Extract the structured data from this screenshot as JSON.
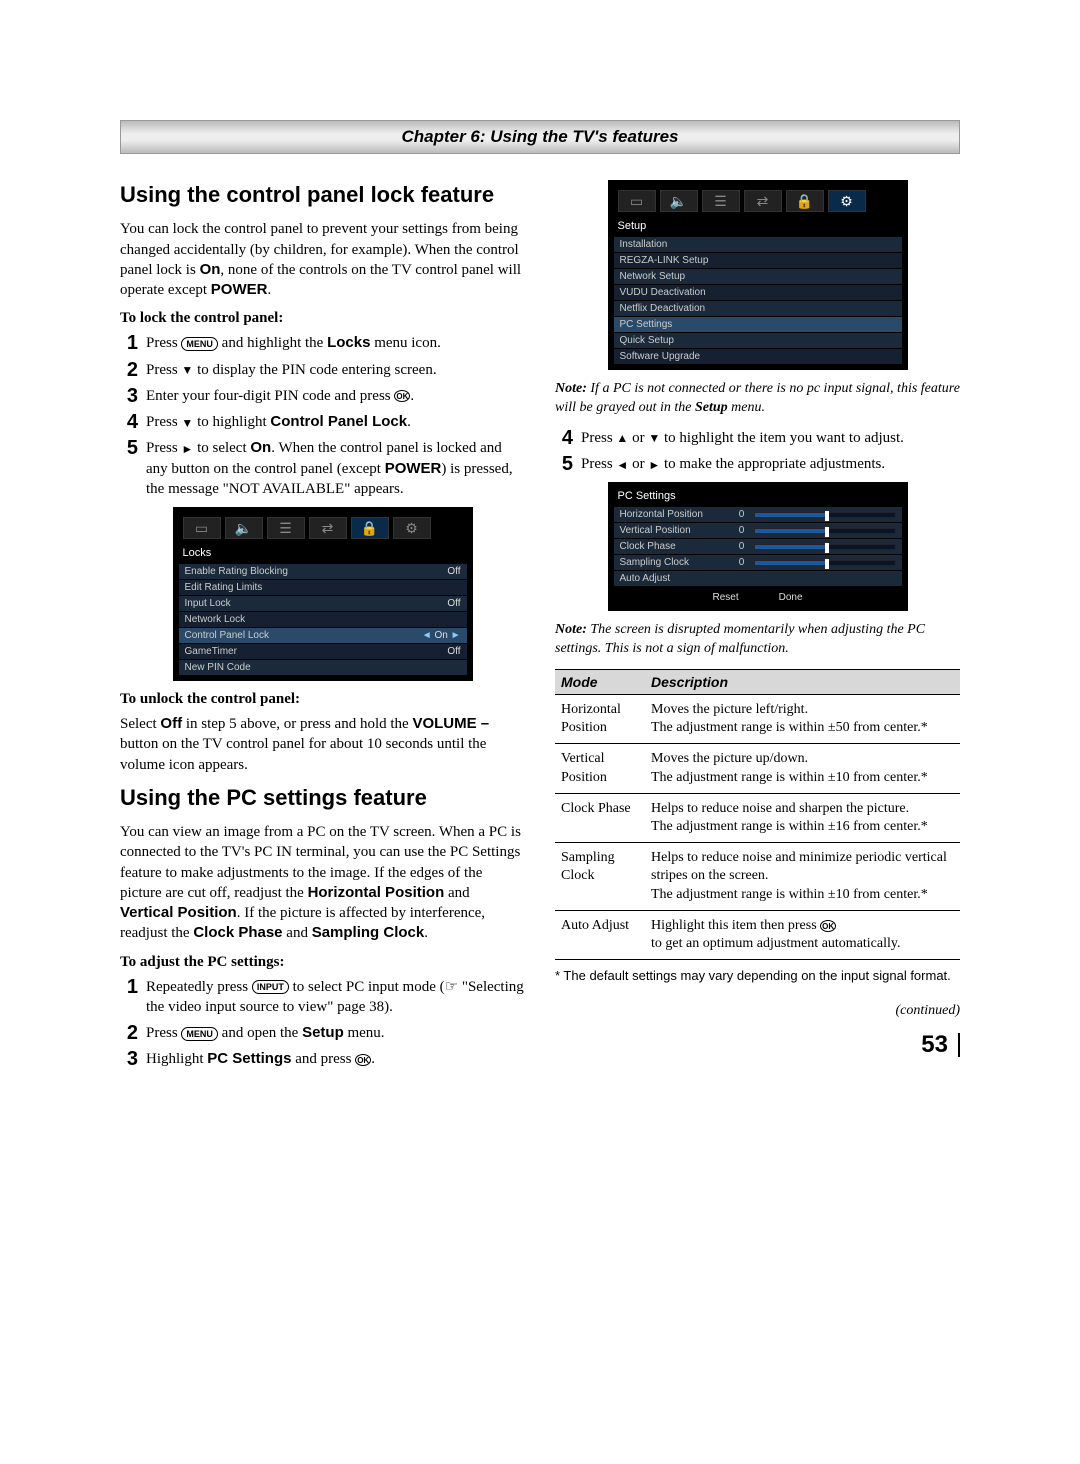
{
  "chapter_bar": "Chapter 6: Using the TV's features",
  "page_number": "53",
  "continued": "(continued)",
  "left": {
    "h1": "Using the control panel lock feature",
    "p1_a": "You can lock the control panel to prevent your settings from being changed accidentally (by children, for example). When the control panel lock is ",
    "p1_on": "On",
    "p1_b": ", none of the controls on the TV control panel will operate except ",
    "p1_power": "POWER",
    "p1_c": ".",
    "sub_lock": "To lock the control panel:",
    "steps_lock": {
      "s1_a": "Press ",
      "s1_btn": "MENU",
      "s1_b": " and highlight the ",
      "s1_c": "Locks",
      "s1_d": " menu icon.",
      "s2_a": "Press ",
      "s2_tri": "▼",
      "s2_b": " to display the PIN code entering screen.",
      "s3_a": "Enter your four-digit PIN code and press ",
      "s3_btn": "OK",
      "s3_b": ".",
      "s4_a": "Press ",
      "s4_tri": "▼",
      "s4_b": " to highlight ",
      "s4_c": "Control Panel Lock",
      "s4_d": ".",
      "s5_a": "Press ",
      "s5_tri": "►",
      "s5_b": " to select ",
      "s5_on": "On",
      "s5_c": ". When the control panel is locked and any button on the control panel (except ",
      "s5_power": "POWER",
      "s5_d": ") is pressed, the message \"NOT AVAILABLE\" appears."
    },
    "locks_menu": {
      "title": "Locks",
      "rows": [
        {
          "label": "Enable Rating Blocking",
          "value": "Off"
        },
        {
          "label": "Edit Rating Limits",
          "value": ""
        },
        {
          "label": "Input Lock",
          "value": "Off"
        },
        {
          "label": "Network Lock",
          "value": ""
        },
        {
          "label": "Control Panel Lock",
          "value": "On",
          "selected": true
        },
        {
          "label": "GameTimer",
          "value": "Off"
        },
        {
          "label": "New PIN Code",
          "value": ""
        }
      ]
    },
    "sub_unlock": "To unlock the control panel:",
    "unlock_a": "Select ",
    "unlock_off": "Off",
    "unlock_b": " in step 5 above, or press and hold the ",
    "unlock_vol": "VOLUME –",
    "unlock_c": " button on the TV control panel for about 10 seconds until the volume icon appears.",
    "h2": "Using the PC settings feature",
    "p2_a": "You can view an image from a PC on the TV screen. When a PC is connected to the TV's PC IN terminal, you can use the PC Settings feature to make adjustments to the image. If the edges of the picture are cut off, readjust the ",
    "p2_hp": "Horizontal Position",
    "p2_b": " and ",
    "p2_vp": "Vertical Position",
    "p2_c": ". If the picture is affected by interference, readjust the ",
    "p2_cp": "Clock Phase",
    "p2_d": " and ",
    "p2_sc": "Sampling Clock",
    "p2_e": ".",
    "sub_adjust": "To adjust the PC settings:",
    "steps_adjust": {
      "s1_a": "Repeatedly press ",
      "s1_btn": "INPUT",
      "s1_b": " to select PC input mode (☞ \"Selecting the video input source to view\" page 38).",
      "s2_a": "Press ",
      "s2_btn": "MENU",
      "s2_b": " and open the ",
      "s2_setup": "Setup",
      "s2_c": " menu.",
      "s3_a": "Highlight ",
      "s3_pc": "PC Settings",
      "s3_b": " and press ",
      "s3_btn": "OK",
      "s3_c": "."
    }
  },
  "right": {
    "setup_menu": {
      "title": "Setup",
      "rows": [
        {
          "label": "Installation"
        },
        {
          "label": "REGZA-LINK Setup"
        },
        {
          "label": "Network Setup"
        },
        {
          "label": "VUDU Deactivation"
        },
        {
          "label": "Netflix Deactivation"
        },
        {
          "label": "PC Settings",
          "selected": true
        },
        {
          "label": "Quick Setup"
        },
        {
          "label": "Software Upgrade"
        }
      ]
    },
    "note1_label": "Note:",
    "note1_a": " If a PC is not connected or there is no pc input signal, this feature will be grayed out in the ",
    "note1_setup": "Setup",
    "note1_b": " menu.",
    "s4_a": "Press ",
    "s4_up": "▲",
    "s4_or": " or ",
    "s4_dn": "▼",
    "s4_b": " to highlight the item you want to adjust.",
    "s5_a": "Press ",
    "s5_l": "◄",
    "s5_or": " or ",
    "s5_r": "►",
    "s5_b": " to make the appropriate adjustments.",
    "pcmenu": {
      "title": "PC Settings",
      "rows": [
        {
          "label": "Horizontal Position",
          "value": "0"
        },
        {
          "label": "Vertical Position",
          "value": "0"
        },
        {
          "label": "Clock Phase",
          "value": "0"
        },
        {
          "label": "Sampling Clock",
          "value": "0"
        },
        {
          "label": "Auto Adjust",
          "noslider": true
        }
      ],
      "reset": "Reset",
      "done": "Done"
    },
    "note2_label": "Note:",
    "note2": " The screen is disrupted momentarily when adjusting the PC settings. This is not a sign of malfunction.",
    "table": {
      "head_mode": "Mode",
      "head_desc": "Description",
      "rows": [
        {
          "mode": "Horizontal Position",
          "desc": "Moves the picture left/right.\nThe adjustment range is within ±50 from center.*"
        },
        {
          "mode": "Vertical Position",
          "desc": "Moves the picture up/down.\nThe adjustment range is within ±10 from center.*"
        },
        {
          "mode": "Clock Phase",
          "desc": "Helps to reduce noise and sharpen the picture.\nThe adjustment range is within ±16 from center.*"
        },
        {
          "mode": "Sampling Clock",
          "desc": "Helps to reduce noise and minimize periodic vertical stripes on the screen.\nThe adjustment range is within ±10 from center.*"
        }
      ],
      "auto_mode": "Auto Adjust",
      "auto_a": "Highlight this item then press ",
      "auto_btn": "OK",
      "auto_b": "to get an optimum adjustment automatically."
    },
    "footnote": "* The default settings may vary depending on the input signal format."
  }
}
